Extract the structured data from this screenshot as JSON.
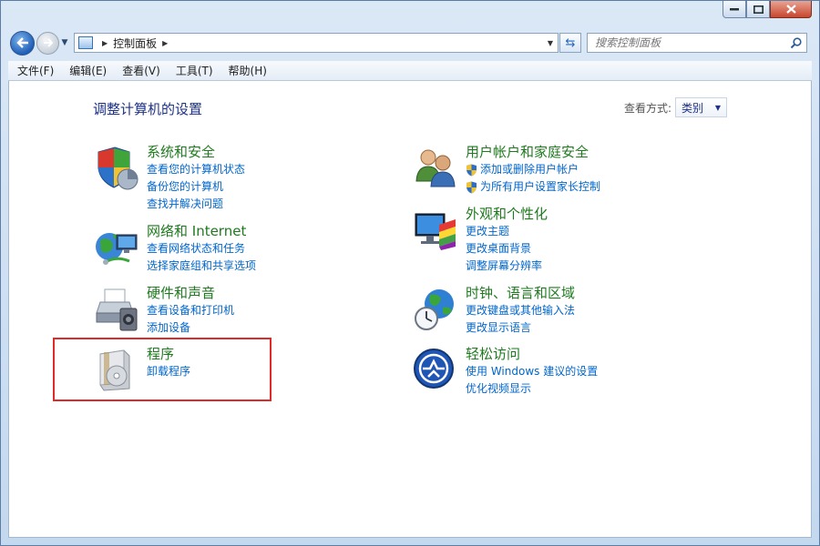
{
  "window": {
    "buttons": [
      "minimize",
      "maximize",
      "close"
    ]
  },
  "nav": {
    "breadcrumb": [
      "控制面板"
    ],
    "search_placeholder": "搜索控制面板"
  },
  "menu": [
    "文件(F)",
    "编辑(E)",
    "查看(V)",
    "工具(T)",
    "帮助(H)"
  ],
  "page": {
    "title": "调整计算机的设置",
    "view_by_label": "查看方式:",
    "view_by_value": "类别"
  },
  "categories": [
    {
      "title": "系统和安全",
      "icon": "shield-pie-icon",
      "links": [
        "查看您的计算机状态",
        "备份您的计算机",
        "查找并解决问题"
      ]
    },
    {
      "title": "网络和 Internet",
      "icon": "network-globe-icon",
      "links": [
        "查看网络状态和任务",
        "选择家庭组和共享选项"
      ]
    },
    {
      "title": "硬件和声音",
      "icon": "printer-speaker-icon",
      "links": [
        "查看设备和打印机",
        "添加设备"
      ]
    },
    {
      "title": "程序",
      "icon": "programs-disc-icon",
      "links": [
        "卸载程序"
      ]
    },
    {
      "title": "用户帐户和家庭安全",
      "icon": "users-icon",
      "links": [
        "添加或删除用户帐户",
        "为所有用户设置家长控制"
      ]
    },
    {
      "title": "外观和个性化",
      "icon": "monitor-palette-icon",
      "links": [
        "更改主题",
        "更改桌面背景",
        "调整屏幕分辨率"
      ]
    },
    {
      "title": "时钟、语言和区域",
      "icon": "globe-clock-icon",
      "links": [
        "更改键盘或其他输入法",
        "更改显示语言"
      ]
    },
    {
      "title": "轻松访问",
      "icon": "ease-of-access-icon",
      "links": [
        "使用 Windows 建议的设置",
        "优化视频显示"
      ]
    }
  ],
  "colors": {
    "category_title": "#1f7a1f",
    "link": "#0066cc",
    "highlight": "#e02a2a"
  }
}
